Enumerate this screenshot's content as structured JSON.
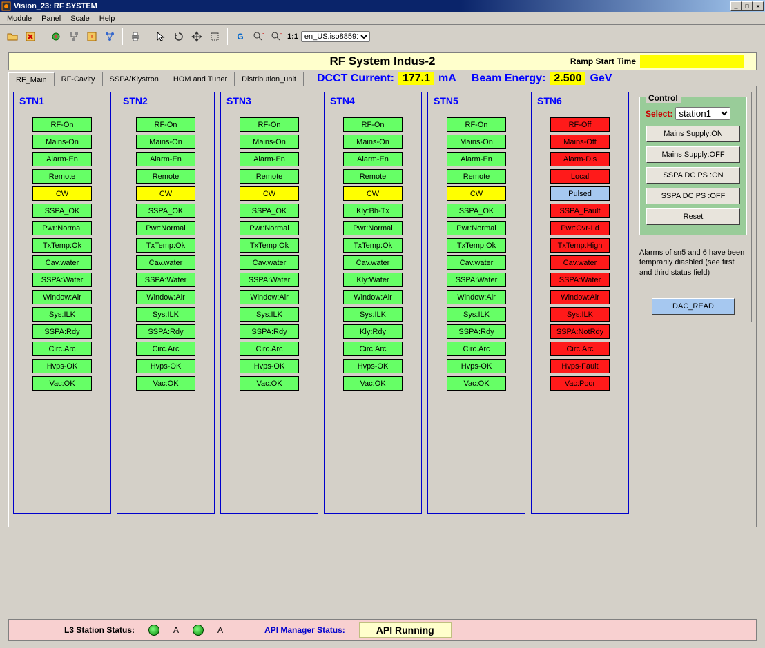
{
  "window": {
    "title": "Vision_23: RF SYSTEM",
    "min": "_",
    "max": "□",
    "close": "×"
  },
  "menu": {
    "items": [
      "Module",
      "Panel",
      "Scale",
      "Help"
    ]
  },
  "toolbar": {
    "zoom11": "1:1",
    "encoding": "en_US.iso88591"
  },
  "banner": {
    "title": "RF System  Indus-2",
    "ramp_label": "Ramp Start Time",
    "ramp_value": ""
  },
  "tabs": [
    "RF_Main",
    "RF-Cavity",
    "SSPA/Klystron",
    "HOM and Tuner",
    "Distribution_unit"
  ],
  "readouts": {
    "dcct_label": "DCCT Current:",
    "dcct_value": "177.1",
    "dcct_unit": "mA",
    "beam_label": "Beam Energy:",
    "beam_value": "2.500",
    "beam_unit": "GeV"
  },
  "stations": [
    {
      "name": "STN1",
      "rows": [
        {
          "t": "RF-On",
          "c": "g"
        },
        {
          "t": "Mains-On",
          "c": "g"
        },
        {
          "t": "Alarm-En",
          "c": "g"
        },
        {
          "t": "Remote",
          "c": "g"
        },
        {
          "t": "CW",
          "c": "y"
        },
        {
          "t": "SSPA_OK",
          "c": "g"
        },
        {
          "t": "Pwr:Normal",
          "c": "g"
        },
        {
          "t": "TxTemp:Ok",
          "c": "g"
        },
        {
          "t": "Cav.water",
          "c": "g"
        },
        {
          "t": "SSPA:Water",
          "c": "g"
        },
        {
          "t": "Window:Air",
          "c": "g"
        },
        {
          "t": "Sys:ILK",
          "c": "g"
        },
        {
          "t": "SSPA:Rdy",
          "c": "g"
        },
        {
          "t": "Circ.Arc",
          "c": "g"
        },
        {
          "t": "Hvps-OK",
          "c": "g"
        },
        {
          "t": "Vac:OK",
          "c": "g"
        }
      ]
    },
    {
      "name": "STN2",
      "rows": [
        {
          "t": "RF-On",
          "c": "g"
        },
        {
          "t": "Mains-On",
          "c": "g"
        },
        {
          "t": "Alarm-En",
          "c": "g"
        },
        {
          "t": "Remote",
          "c": "g"
        },
        {
          "t": "CW",
          "c": "y"
        },
        {
          "t": "SSPA_OK",
          "c": "g"
        },
        {
          "t": "Pwr:Normal",
          "c": "g"
        },
        {
          "t": "TxTemp:Ok",
          "c": "g"
        },
        {
          "t": "Cav.water",
          "c": "g"
        },
        {
          "t": "SSPA:Water",
          "c": "g"
        },
        {
          "t": "Window:Air",
          "c": "g"
        },
        {
          "t": "Sys:ILK",
          "c": "g"
        },
        {
          "t": "SSPA:Rdy",
          "c": "g"
        },
        {
          "t": "Circ.Arc",
          "c": "g"
        },
        {
          "t": "Hvps-OK",
          "c": "g"
        },
        {
          "t": "Vac:OK",
          "c": "g"
        }
      ]
    },
    {
      "name": "STN3",
      "rows": [
        {
          "t": "RF-On",
          "c": "g"
        },
        {
          "t": "Mains-On",
          "c": "g"
        },
        {
          "t": "Alarm-En",
          "c": "g"
        },
        {
          "t": "Remote",
          "c": "g"
        },
        {
          "t": "CW",
          "c": "y"
        },
        {
          "t": "SSPA_OK",
          "c": "g"
        },
        {
          "t": "Pwr:Normal",
          "c": "g"
        },
        {
          "t": "TxTemp:Ok",
          "c": "g"
        },
        {
          "t": "Cav.water",
          "c": "g"
        },
        {
          "t": "SSPA:Water",
          "c": "g"
        },
        {
          "t": "Window:Air",
          "c": "g"
        },
        {
          "t": "Sys:ILK",
          "c": "g"
        },
        {
          "t": "SSPA:Rdy",
          "c": "g"
        },
        {
          "t": "Circ.Arc",
          "c": "g"
        },
        {
          "t": "Hvps-OK",
          "c": "g"
        },
        {
          "t": "Vac:OK",
          "c": "g"
        }
      ]
    },
    {
      "name": "STN4",
      "rows": [
        {
          "t": "RF-On",
          "c": "g"
        },
        {
          "t": "Mains-On",
          "c": "g"
        },
        {
          "t": "Alarm-En",
          "c": "g"
        },
        {
          "t": "Remote",
          "c": "g"
        },
        {
          "t": "CW",
          "c": "y"
        },
        {
          "t": "Kly:Bh-Tx",
          "c": "g"
        },
        {
          "t": "Pwr:Normal",
          "c": "g"
        },
        {
          "t": "TxTemp:Ok",
          "c": "g"
        },
        {
          "t": "Cav.water",
          "c": "g"
        },
        {
          "t": "Kly:Water",
          "c": "g"
        },
        {
          "t": "Window:Air",
          "c": "g"
        },
        {
          "t": "Sys:ILK",
          "c": "g"
        },
        {
          "t": "Kly:Rdy",
          "c": "g"
        },
        {
          "t": "Circ.Arc",
          "c": "g"
        },
        {
          "t": "Hvps-OK",
          "c": "g"
        },
        {
          "t": "Vac:OK",
          "c": "g"
        }
      ]
    },
    {
      "name": "STN5",
      "rows": [
        {
          "t": "RF-On",
          "c": "g"
        },
        {
          "t": "Mains-On",
          "c": "g"
        },
        {
          "t": "Alarm-En",
          "c": "g"
        },
        {
          "t": "Remote",
          "c": "g"
        },
        {
          "t": "CW",
          "c": "y"
        },
        {
          "t": "SSPA_OK",
          "c": "g"
        },
        {
          "t": "Pwr:Normal",
          "c": "g"
        },
        {
          "t": "TxTemp:Ok",
          "c": "g"
        },
        {
          "t": "Cav.water",
          "c": "g"
        },
        {
          "t": "SSPA:Water",
          "c": "g"
        },
        {
          "t": "Window:Air",
          "c": "g"
        },
        {
          "t": "Sys:ILK",
          "c": "g"
        },
        {
          "t": "SSPA:Rdy",
          "c": "g"
        },
        {
          "t": "Circ.Arc",
          "c": "g"
        },
        {
          "t": "Hvps-OK",
          "c": "g"
        },
        {
          "t": "Vac:OK",
          "c": "g"
        }
      ]
    },
    {
      "name": "STN6",
      "rows": [
        {
          "t": "RF-Off",
          "c": "r"
        },
        {
          "t": "Mains-Off",
          "c": "r"
        },
        {
          "t": "Alarm-Dis",
          "c": "r"
        },
        {
          "t": "Local",
          "c": "r"
        },
        {
          "t": "Pulsed",
          "c": "b"
        },
        {
          "t": "SSPA_Fault",
          "c": "r"
        },
        {
          "t": "Pwr:Ovr-Ld",
          "c": "r"
        },
        {
          "t": "TxTemp:High",
          "c": "r"
        },
        {
          "t": "Cav.water",
          "c": "r"
        },
        {
          "t": "SSPA:Water",
          "c": "r"
        },
        {
          "t": "Window:Air",
          "c": "r"
        },
        {
          "t": "Sys:ILK",
          "c": "r"
        },
        {
          "t": "SSPA:NotRdy",
          "c": "r"
        },
        {
          "t": "Circ.Arc",
          "c": "r"
        },
        {
          "t": "Hvps-Fault",
          "c": "r"
        },
        {
          "t": "Vac:Poor",
          "c": "r"
        }
      ]
    }
  ],
  "control": {
    "legend": "Control",
    "select_label": "Select:",
    "select_value": "station1",
    "buttons": [
      "Mains Supply:ON",
      "Mains Supply:OFF",
      "SSPA DC PS :ON",
      "SSPA DC PS :OFF",
      "Reset"
    ],
    "info": "Alarms of sn5 and 6 have been temprarily diasbled (see first and third status field)",
    "dac": "DAC_READ"
  },
  "footer": {
    "l3_label": "L3 Station Status:",
    "A": "A",
    "api_label": "API Manager Status:",
    "api_value": "API Running"
  }
}
